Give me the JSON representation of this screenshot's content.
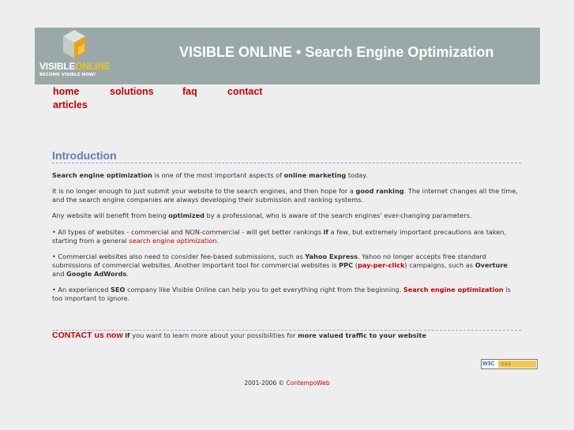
{
  "header": {
    "logo_name_part1": "VISIBLE",
    "logo_name_part2": "ONLINE",
    "logo_tagline": "BECOME VISIBLE NOW!",
    "site_title": "VISIBLE ONLINE • Search Engine Optimization"
  },
  "nav": {
    "items": [
      "home",
      "solutions",
      "faq",
      "contact",
      "articles"
    ]
  },
  "content": {
    "heading": "Introduction",
    "p1": {
      "a": "Search engine optimization",
      "b": " is one of the most important aspects of ",
      "c": "online marketing",
      "d": " today."
    },
    "p2": {
      "a": "It is no longer enough to just submit your website to the search engines, and then hope for a ",
      "b": "good ranking",
      "c": ". The internet changes all the time, and the search engine companies are always developing their submission and ranking systems."
    },
    "p3": {
      "a": "Any website will benefit from being ",
      "b": "optimized",
      "c": " by a professional, who is aware of the search engines' ever-changing parameters."
    },
    "p4": {
      "a": "• All types of websites - commercial and NON-commercial - will get better rankings ",
      "b": "if",
      "c": " a few, but extremely important precautions are taken, starting from a general ",
      "link": "search engine optimization",
      "d": "."
    },
    "p5": {
      "a": "• Commercial websites also need to consider fee-based submissions, such as ",
      "b": "Yahoo Express",
      "c": ". Yahoo no longer accepts free standard submissions of commercial websites. Another important tool for commercial websites is ",
      "d": "PPC",
      "e": " (",
      "link": "pay-per-click",
      "f": ") campaigns, such as ",
      "g": "Overture",
      "h": " and ",
      "i": "Google AdWords",
      "j": "."
    },
    "p6": {
      "a": "• An experienced ",
      "b": "SEO",
      "c": " company like Visible Online can help you to get everything right from the beginning. ",
      "link": "Search engine optimization",
      "d": " is too important to ignore."
    },
    "cta": {
      "link": "CONTACT us now",
      "a": " ",
      "b": "if",
      "c": " you want to learn more about your possibilities for ",
      "d": "more valued traffic to your website"
    }
  },
  "badge": {
    "w3c": "W3C",
    "css": "css"
  },
  "footer": {
    "text": "2001-2006 © ",
    "link": "ContempoWeb"
  },
  "colors": {
    "header_bg": "#9aa9a8",
    "page_bg": "#eeeeee",
    "link_red": "#c80000",
    "heading_blue": "#5b80b4",
    "logo_accent": "#f3c11a"
  }
}
